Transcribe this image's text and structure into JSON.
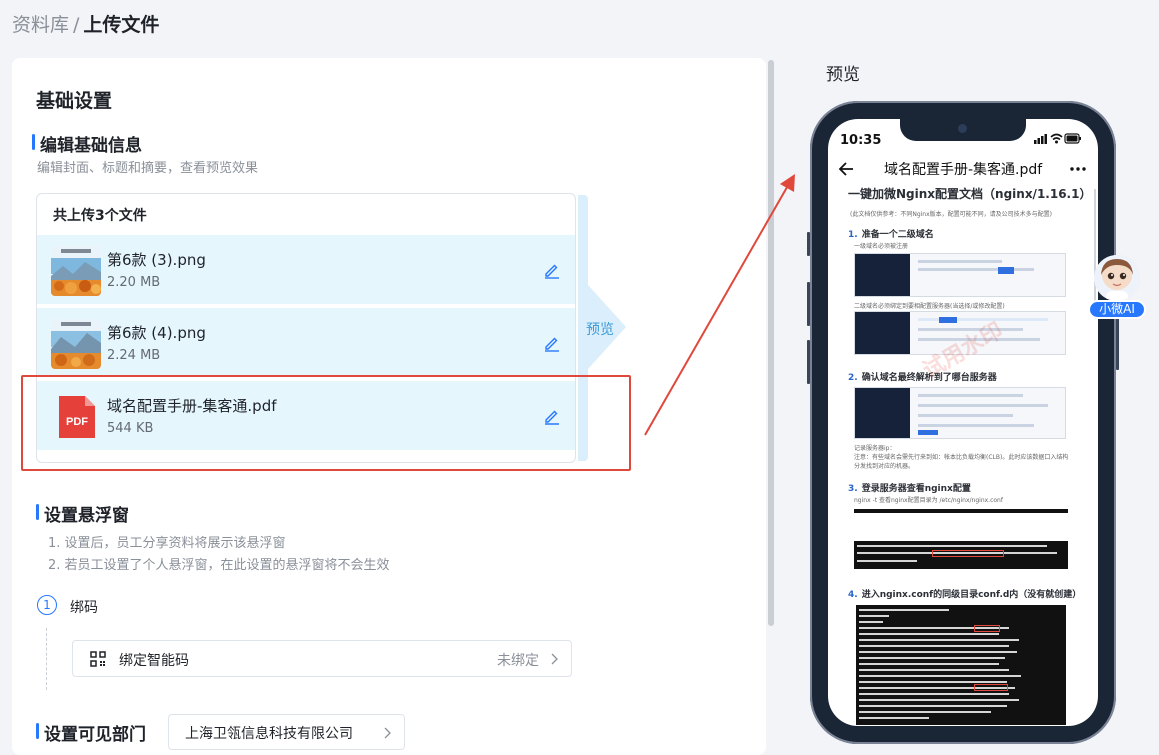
{
  "breadcrumb": {
    "parent": "资料库",
    "separator": "/",
    "current": "上传文件"
  },
  "basic": {
    "title": "基础设置",
    "edit_title": "编辑基础信息",
    "edit_desc": "编辑封面、标题和摘要，查看预览效果",
    "files_header": "共上传3个文件",
    "files": [
      {
        "name": "第6款 (3).png",
        "size": "2.20 MB",
        "thumb": "landscape-image"
      },
      {
        "name": "第6款 (4).png",
        "size": "2.24 MB",
        "thumb": "landscape-image"
      },
      {
        "name": "域名配置手册-集客通.pdf",
        "size": "544 KB",
        "thumb": "pdf-icon",
        "thumb_text": "PDF"
      }
    ],
    "preview_tab": "预览"
  },
  "floating": {
    "title": "设置悬浮窗",
    "notes": [
      "1. 设置后，员工分享资料将展示该悬浮窗",
      "2. 若员工设置了个人悬浮窗，在此设置的悬浮窗将不会生效"
    ],
    "step_number": "1",
    "step_label": "绑码",
    "bind_label": "绑定智能码",
    "bind_status": "未绑定"
  },
  "dept": {
    "title": "设置可见部门",
    "value": "上海卫瓴信息科技有限公司"
  },
  "preview": {
    "title": "预览",
    "status_time": "10:35",
    "nav_title": "域名配置手册-集客通.pdf",
    "doc": {
      "heading": "一键加微Nginx配置文档（nginx/1.16.1）",
      "intro": "(此文档仅供参考：不同Nginx版本，配置可能不同，请及公司技术多与配置)",
      "steps": [
        {
          "n": "1.",
          "text": "准备一个二级域名"
        },
        {
          "n": "2.",
          "text": "确认域名最终解析到了哪台服务器"
        },
        {
          "n": "3.",
          "text": "登录服务器查看nginx配置"
        },
        {
          "n": "4.",
          "text": "进入nginx.conf的同级目录conf.d内（没有就创建）"
        }
      ],
      "small_1": "一级域名必须被注册",
      "small_2": "二级域名必须绑定到要相配置服务器(当选择/或修改配置)",
      "small_3": "记录服务器ip：",
      "small_4": "注意：有些域名会需先行来到如：帐本比负载均衡(CLB)。此时应该数据口入结构分发找到对应的机器。",
      "small_5": "nginx -t 查看nginx配置目录为 /etc/nginx/nginx.conf",
      "watermark": "试用水印"
    },
    "ai_label": "小微AI"
  },
  "colors": {
    "accent": "#2878ff",
    "highlight": "#e0483b",
    "file_bg": "#e6f6fd"
  }
}
